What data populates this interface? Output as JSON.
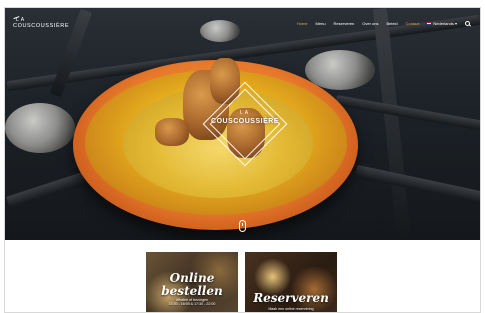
{
  "brand": {
    "la": "LA",
    "name": "COUSCOUSSIÈRE"
  },
  "nav": {
    "items": [
      {
        "label": "Home",
        "active": true
      },
      {
        "label": "Menu",
        "active": false
      },
      {
        "label": "Reserveren",
        "active": false
      },
      {
        "label": "Over ons",
        "active": false
      },
      {
        "label": "Beleid",
        "active": false
      },
      {
        "label": "Contact",
        "active": false
      }
    ],
    "language": "Nederlands",
    "language_caret": "▾"
  },
  "hero": {
    "logo_la": "LA",
    "logo_name": "COUSCOUSSIÈRE"
  },
  "cards": {
    "online": {
      "title_line1": "Online",
      "title_line2": "bestellen",
      "sub_line1": "Afhalen of bezorgen",
      "sub_line2": "15:30 - 16:00 & 17:30 - 22:00"
    },
    "reserve": {
      "title": "Reserveren",
      "sub": "Maak een online reservering"
    }
  },
  "colors": {
    "accent": "#d7a844",
    "nav_text": "#ffffff"
  }
}
